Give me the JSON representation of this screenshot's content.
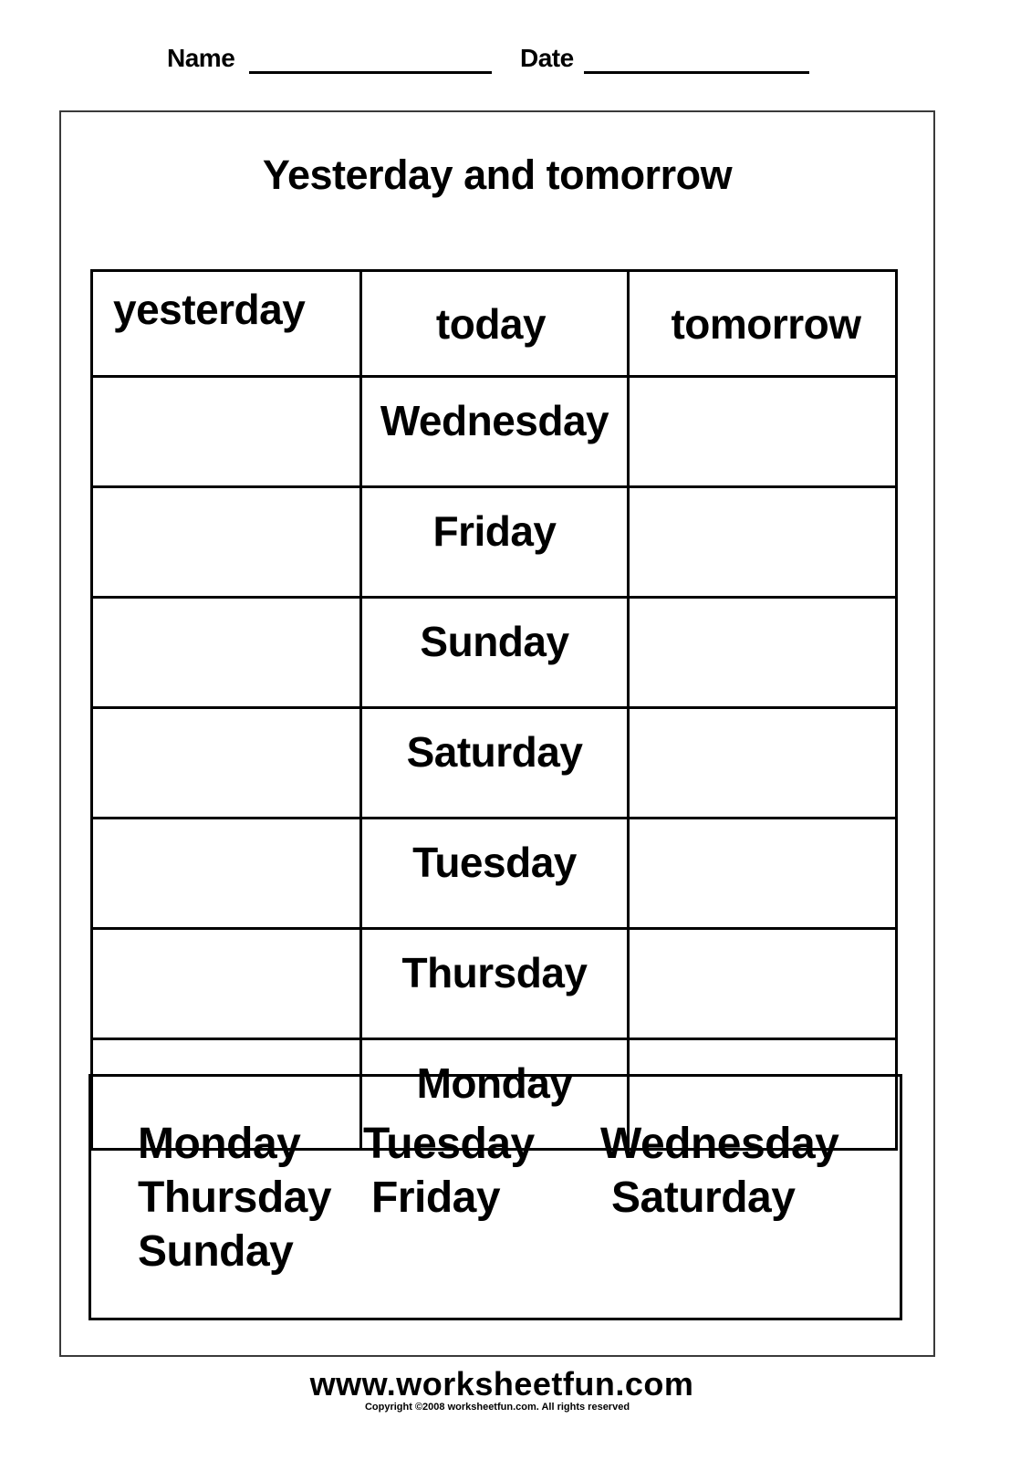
{
  "header": {
    "name_label": "Name",
    "name_value": "",
    "date_label": "Date",
    "date_value": ""
  },
  "worksheet": {
    "title": "Yesterday and tomorrow",
    "table": {
      "columns": [
        "yesterday",
        "today",
        "tomorrow"
      ],
      "rows": [
        {
          "yesterday": "",
          "today": "Wednesday",
          "tomorrow": ""
        },
        {
          "yesterday": "",
          "today": "Friday",
          "tomorrow": ""
        },
        {
          "yesterday": "",
          "today": "Sunday",
          "tomorrow": ""
        },
        {
          "yesterday": "",
          "today": "Saturday",
          "tomorrow": ""
        },
        {
          "yesterday": "",
          "today": "Tuesday",
          "tomorrow": ""
        },
        {
          "yesterday": "",
          "today": "Thursday",
          "tomorrow": ""
        },
        {
          "yesterday": "",
          "today": "Monday",
          "tomorrow": ""
        }
      ]
    },
    "word_bank": [
      "Monday",
      "Tuesday",
      "Wednesday",
      "Thursday",
      "Friday",
      "Saturday",
      "Sunday"
    ]
  },
  "footer": {
    "url": "www.worksheetfun.com",
    "copyright": "Copyright ©2008 worksheetfun.com. All rights reserved"
  }
}
